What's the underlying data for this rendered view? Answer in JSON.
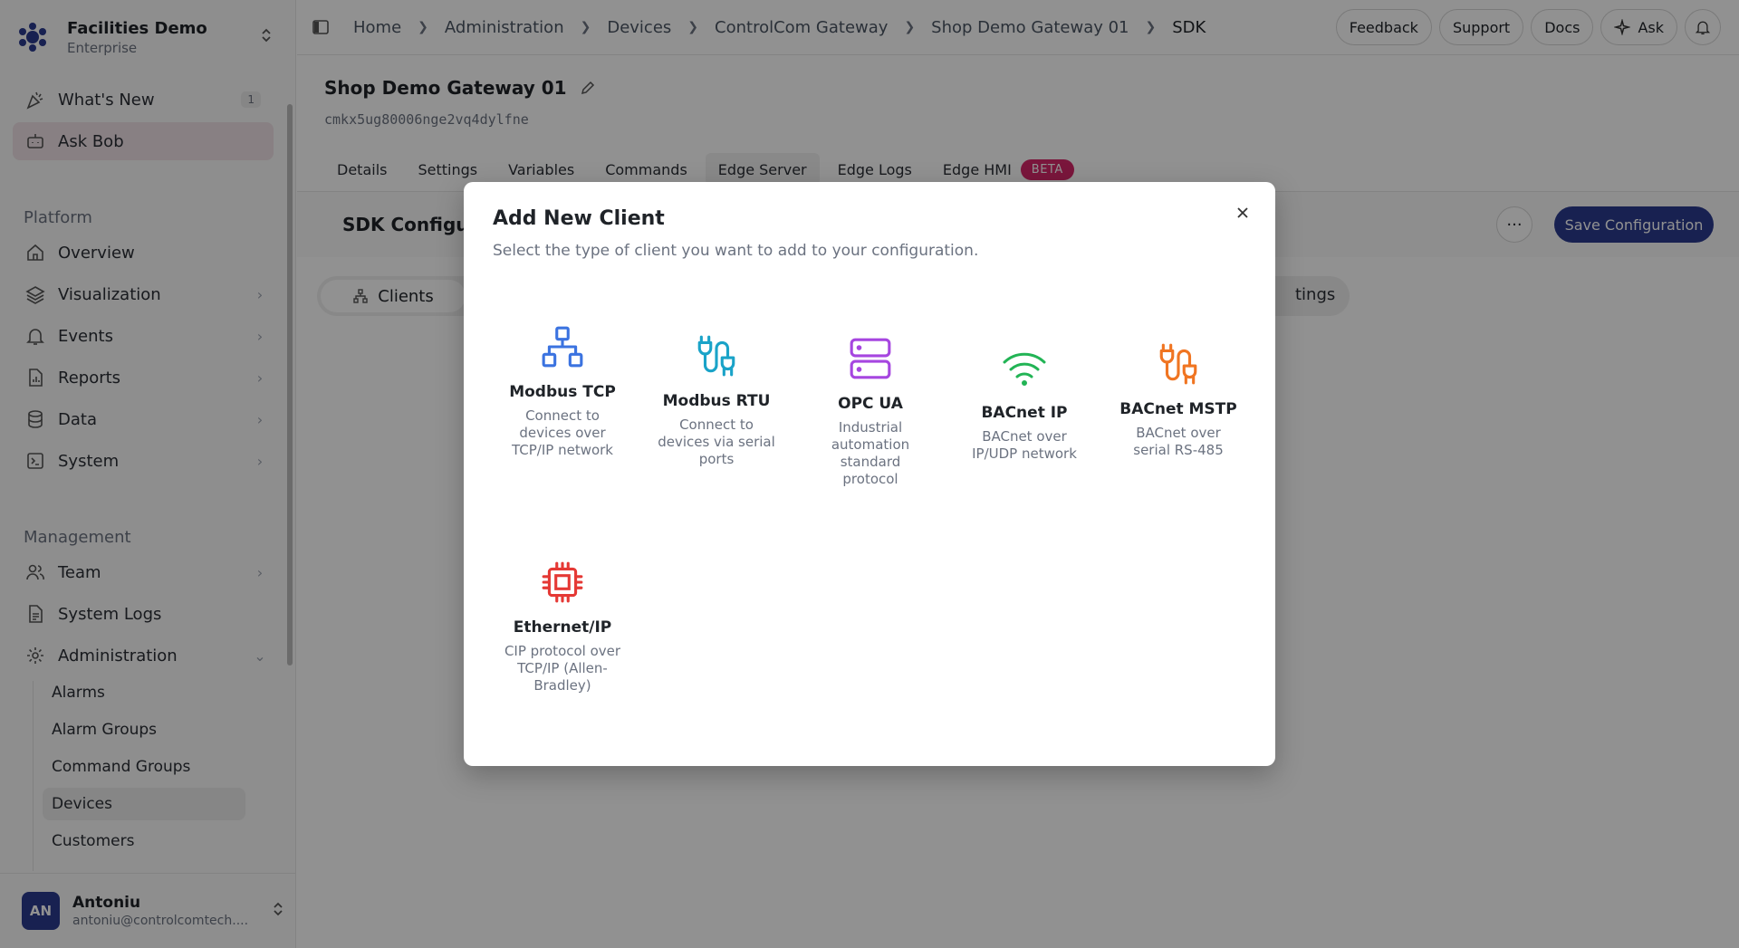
{
  "org": {
    "name": "Facilities Demo",
    "plan": "Enterprise"
  },
  "sidebar": {
    "top_items": [
      {
        "label": "What's New",
        "badge": "1"
      },
      {
        "label": "Ask Bob"
      }
    ],
    "platform_label": "Platform",
    "platform_items": [
      {
        "label": "Overview"
      },
      {
        "label": "Visualization"
      },
      {
        "label": "Events"
      },
      {
        "label": "Reports"
      },
      {
        "label": "Data"
      },
      {
        "label": "System"
      }
    ],
    "management_label": "Management",
    "management_items": [
      {
        "label": "Team"
      },
      {
        "label": "System Logs"
      },
      {
        "label": "Administration"
      }
    ],
    "admin_sub_items": [
      {
        "label": "Alarms"
      },
      {
        "label": "Alarm Groups"
      },
      {
        "label": "Command Groups"
      },
      {
        "label": "Devices"
      },
      {
        "label": "Customers"
      }
    ]
  },
  "user": {
    "initials": "AN",
    "name": "Antoniu",
    "email": "antoniu@controlcomtech...."
  },
  "breadcrumb": [
    "Home",
    "Administration",
    "Devices",
    "ControlCom Gateway",
    "Shop Demo Gateway 01",
    "SDK"
  ],
  "top_actions": {
    "feedback": "Feedback",
    "support": "Support",
    "docs": "Docs",
    "ask": "Ask"
  },
  "device": {
    "title": "Shop Demo Gateway 01",
    "id": "cmkx5ug80006nge2vq4dylfne"
  },
  "tabs": [
    "Details",
    "Settings",
    "Variables",
    "Commands",
    "Edge Server",
    "Edge Logs",
    "Edge HMI"
  ],
  "beta_label": "BETA",
  "sdk": {
    "title": "SDK Configur",
    "save_label": "Save Configuration",
    "more_label": "···"
  },
  "subtabs": {
    "clients": "Clients",
    "settings_partial": "tings"
  },
  "modal": {
    "title": "Add New Client",
    "subtitle": "Select the type of client you want to add to your configuration.",
    "clients": [
      {
        "name": "Modbus TCP",
        "desc": "Connect to devices over TCP/IP network",
        "icon": "network-icon",
        "color": "#3b73e0"
      },
      {
        "name": "Modbus RTU",
        "desc": "Connect to devices via serial ports",
        "icon": "cable-icon",
        "color": "#1aa3c8"
      },
      {
        "name": "OPC UA",
        "desc": "Industrial automation standard protocol",
        "icon": "server-icon",
        "color": "#a646e0"
      },
      {
        "name": "BACnet IP",
        "desc": "BACnet over IP/UDP network",
        "icon": "wifi-icon",
        "color": "#22b455"
      },
      {
        "name": "BACnet MSTP",
        "desc": "BACnet over serial RS-485",
        "icon": "cable-icon",
        "color": "#f07522"
      },
      {
        "name": "Ethernet/IP",
        "desc": "CIP protocol over TCP/IP (Allen-Bradley)",
        "icon": "chip-icon",
        "color": "#e53935"
      }
    ]
  },
  "colors": {
    "primary": "#2b3a8f",
    "beta": "#d6286a",
    "active_nav": "#f0e2e6"
  }
}
